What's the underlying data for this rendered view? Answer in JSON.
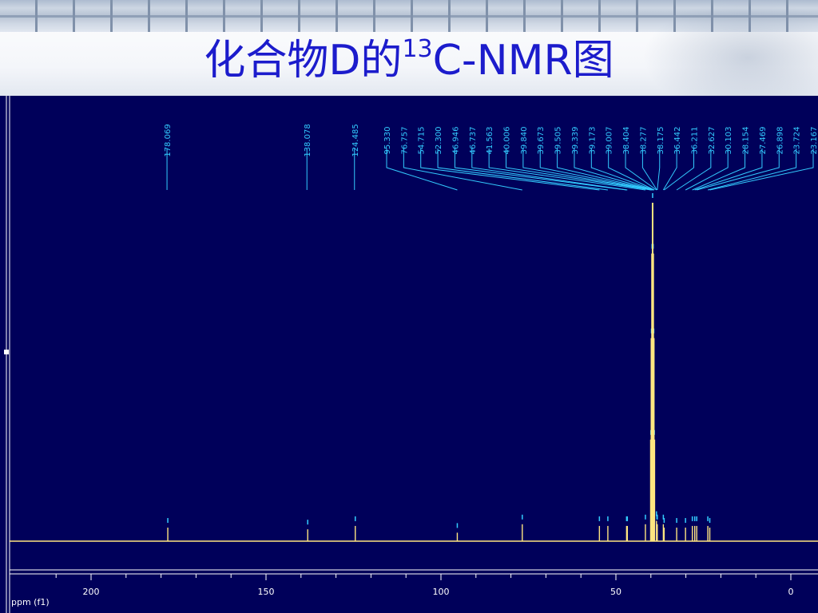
{
  "title": {
    "part1": "化合物D的",
    "sup": "13",
    "part2": "C-NMR图"
  },
  "colors": {
    "background": "#00005a",
    "spectrum": "#ffe680",
    "labels": "#33ccff",
    "axis": "#ffffff",
    "title": "#1c1ccc"
  },
  "chart_data": {
    "type": "line",
    "xlabel": "ppm (f1)",
    "xlim": [
      200,
      0
    ],
    "xticks": [
      200,
      150,
      100,
      50,
      0
    ],
    "grid": false,
    "peak_labels": [
      178.069,
      138.078,
      124.485,
      95.33,
      76.757,
      54.715,
      52.3,
      46.946,
      46.737,
      41.563,
      40.006,
      39.84,
      39.673,
      39.505,
      39.339,
      39.173,
      39.007,
      38.404,
      38.277,
      38.175,
      36.442,
      36.211,
      32.627,
      30.103,
      28.154,
      27.469,
      26.898,
      23.724,
      23.167
    ],
    "peaks": [
      {
        "ppm": 178.069,
        "intensity": 0.04
      },
      {
        "ppm": 138.078,
        "intensity": 0.035
      },
      {
        "ppm": 124.485,
        "intensity": 0.045
      },
      {
        "ppm": 95.33,
        "intensity": 0.025
      },
      {
        "ppm": 76.757,
        "intensity": 0.05
      },
      {
        "ppm": 54.715,
        "intensity": 0.045
      },
      {
        "ppm": 52.3,
        "intensity": 0.045
      },
      {
        "ppm": 46.946,
        "intensity": 0.045
      },
      {
        "ppm": 46.737,
        "intensity": 0.045
      },
      {
        "ppm": 41.563,
        "intensity": 0.05
      },
      {
        "ppm": 40.006,
        "intensity": 0.3
      },
      {
        "ppm": 39.84,
        "intensity": 0.6
      },
      {
        "ppm": 39.673,
        "intensity": 0.85
      },
      {
        "ppm": 39.505,
        "intensity": 1.0
      },
      {
        "ppm": 39.339,
        "intensity": 0.85
      },
      {
        "ppm": 39.173,
        "intensity": 0.6
      },
      {
        "ppm": 39.007,
        "intensity": 0.3
      },
      {
        "ppm": 38.404,
        "intensity": 0.06
      },
      {
        "ppm": 38.277,
        "intensity": 0.05
      },
      {
        "ppm": 38.175,
        "intensity": 0.05
      },
      {
        "ppm": 36.442,
        "intensity": 0.05
      },
      {
        "ppm": 36.211,
        "intensity": 0.04
      },
      {
        "ppm": 32.627,
        "intensity": 0.04
      },
      {
        "ppm": 30.103,
        "intensity": 0.04
      },
      {
        "ppm": 28.154,
        "intensity": 0.045
      },
      {
        "ppm": 27.469,
        "intensity": 0.045
      },
      {
        "ppm": 26.898,
        "intensity": 0.045
      },
      {
        "ppm": 23.724,
        "intensity": 0.045
      },
      {
        "ppm": 23.167,
        "intensity": 0.04
      }
    ]
  }
}
